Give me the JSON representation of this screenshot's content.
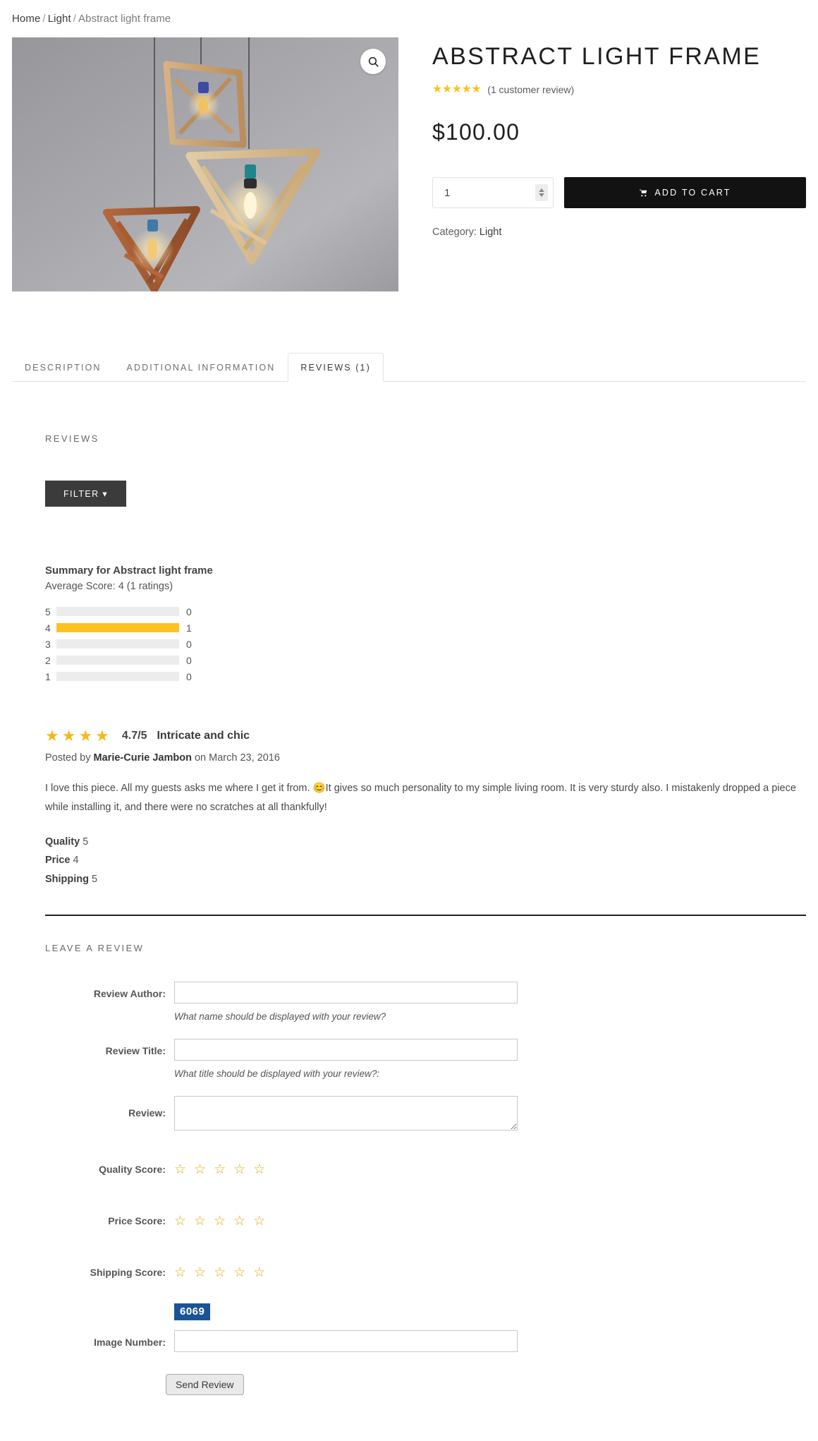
{
  "breadcrumb": {
    "home": "Home",
    "category": "Light",
    "separator": "/",
    "current": "Abstract light frame"
  },
  "gallery": {
    "zoom_icon": "search-icon",
    "alt": "Three triangular wooden frame pendant lamps hanging against a grey wall"
  },
  "product": {
    "title": "ABSTRACT LIGHT FRAME",
    "stars": "★★★★★",
    "review_count_text": "(1 customer review)",
    "price": "$100.00",
    "quantity_value": "1",
    "add_to_cart_label": "ADD TO CART",
    "category_label": "Category:",
    "category_value": "Light"
  },
  "tabs": [
    {
      "label": "DESCRIPTION",
      "active": false
    },
    {
      "label": "ADDITIONAL INFORMATION",
      "active": false
    },
    {
      "label": "REVIEWS (1)",
      "active": true
    }
  ],
  "reviews_panel": {
    "heading": "REVIEWS",
    "filter_label": "FILTER ▾",
    "summary_title": "Summary for Abstract light frame",
    "summary_average": "Average Score: 4 (1 ratings)"
  },
  "chart_data": {
    "type": "bar",
    "title": "Summary for Abstract light frame",
    "subtitle": "Average Score: 4 (1 ratings)",
    "orientation": "horizontal",
    "categories": [
      "5",
      "4",
      "3",
      "2",
      "1"
    ],
    "values": [
      0,
      1,
      0,
      0,
      0
    ],
    "value_labels": [
      "0",
      "1",
      "0",
      "0",
      "0"
    ],
    "max": 1,
    "xlabel": "",
    "ylabel": "",
    "grid": false,
    "legend": false,
    "bar_color": "#fdc120",
    "track_color": "#ececec"
  },
  "review": {
    "stars": "★★★★",
    "star_count": 4,
    "score": "4.7/5",
    "title": "Intricate and chic",
    "posted_prefix": "Posted by",
    "author": "Marie-Curie Jambon",
    "posted_on": "on",
    "date": "March 23, 2016",
    "body": "I love this piece. All my guests asks me where I get it from. 😊It gives so much personality to my simple living room. It is very sturdy also. I mistakenly dropped a piece while installing it, and there were no scratches at all thankfully!",
    "criteria": [
      {
        "label": "Quality",
        "value": "5"
      },
      {
        "label": "Price",
        "value": "4"
      },
      {
        "label": "Shipping",
        "value": "5"
      }
    ]
  },
  "form": {
    "heading": "LEAVE A REVIEW",
    "author_label": "Review Author:",
    "author_value": "",
    "author_hint": "What name should be displayed with your review?",
    "title_label": "Review Title:",
    "title_value": "",
    "title_hint": "What title should be displayed with your review?:",
    "review_label": "Review:",
    "review_value": "",
    "quality_label": "Quality Score:",
    "price_label": "Price Score:",
    "shipping_label": "Shipping Score:",
    "star_empty": "☆",
    "star_options": [
      "☆",
      "☆",
      "☆",
      "☆",
      "☆"
    ],
    "captcha_code": "6069",
    "image_number_label": "Image Number:",
    "image_number_value": "",
    "submit_label": "Send Review"
  },
  "colors": {
    "accent_star": "#f5c518",
    "bar_fill": "#fdc120",
    "cart_button": "#121212",
    "filter_button": "#3b3b3b",
    "captcha_bg": "#1b5398"
  }
}
